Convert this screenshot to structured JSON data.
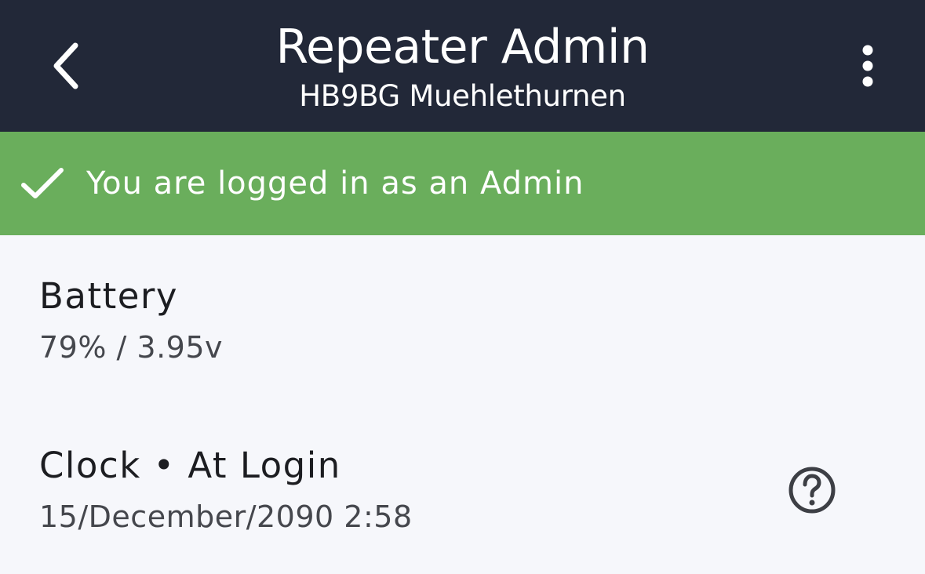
{
  "header": {
    "title": "Repeater Admin",
    "subtitle": "HB9BG Muehlethurnen",
    "back_icon": "chevron-left-icon",
    "menu_icon": "more-vertical-icon",
    "background": "#222838"
  },
  "banner": {
    "icon": "check-icon",
    "text": "You are logged in as an Admin",
    "background": "#6aae5c"
  },
  "items": [
    {
      "title": "Battery",
      "value": "79% / 3.95v"
    },
    {
      "title": "Clock • At Login",
      "value": "15/December/2090 2:58",
      "action_icon": "help-circle-icon"
    }
  ],
  "colors": {
    "page_background": "#f6f7fb",
    "primary_text": "#1c1d21",
    "secondary_text": "#45474d"
  }
}
